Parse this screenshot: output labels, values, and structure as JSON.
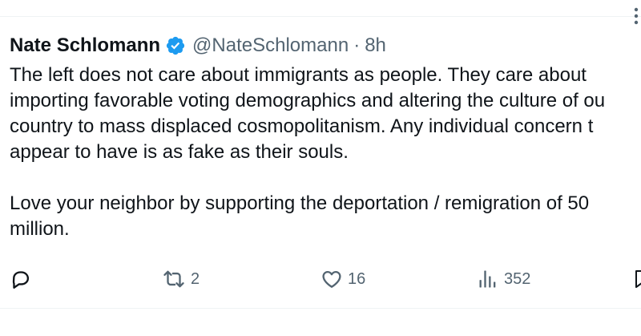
{
  "tweet": {
    "display_name": "Nate Schlomann",
    "handle": "@NateSchlomann",
    "separator": "·",
    "time": "8h",
    "lines_p1": [
      "The left does not care about immigrants as people. They care about",
      "importing favorable voting demographics and altering the culture of ou",
      "country to mass displaced cosmopolitanism. Any individual concern t",
      "appear to have is as fake as their souls."
    ],
    "lines_p2": [
      "Love your neighbor by supporting the deportation / remigration of 50",
      "million."
    ]
  },
  "actions": {
    "reply_icon": "reply-icon",
    "repost_icon": "repost-icon",
    "repost_count": "2",
    "like_icon": "heart-icon",
    "like_count": "16",
    "views_icon": "views-icon",
    "views_count": "352",
    "bookmark_icon": "bookmark-icon"
  },
  "colors": {
    "text": "#0f1419",
    "secondary": "#536471",
    "verified": "#1d9bf0",
    "divider": "#eff3f4"
  }
}
